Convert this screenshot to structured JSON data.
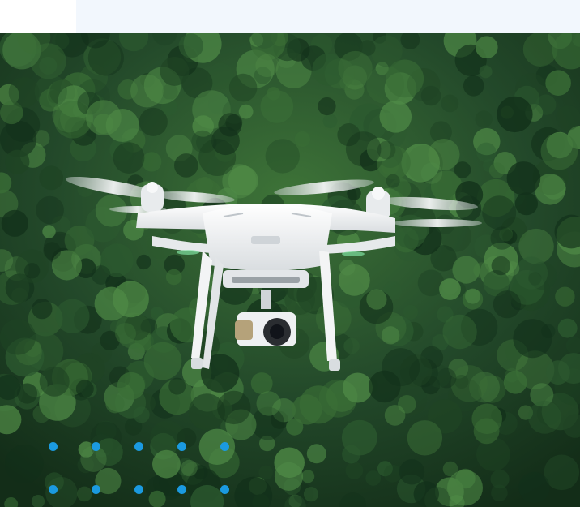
{
  "image": {
    "subject": "drone-icon",
    "background": "forest"
  },
  "colors": {
    "top_band": "#f2f7fd",
    "forest_dark": "#12301a",
    "forest_mid": "#2c5a2f",
    "forest_light": "#4f8a46",
    "drone_body": "#f1f3f4",
    "drone_shadow": "#c9ced2",
    "camera": "#2a2d31",
    "dot": "#1b9ae0"
  },
  "dot_grid": {
    "rows": 2,
    "cols": 5
  }
}
